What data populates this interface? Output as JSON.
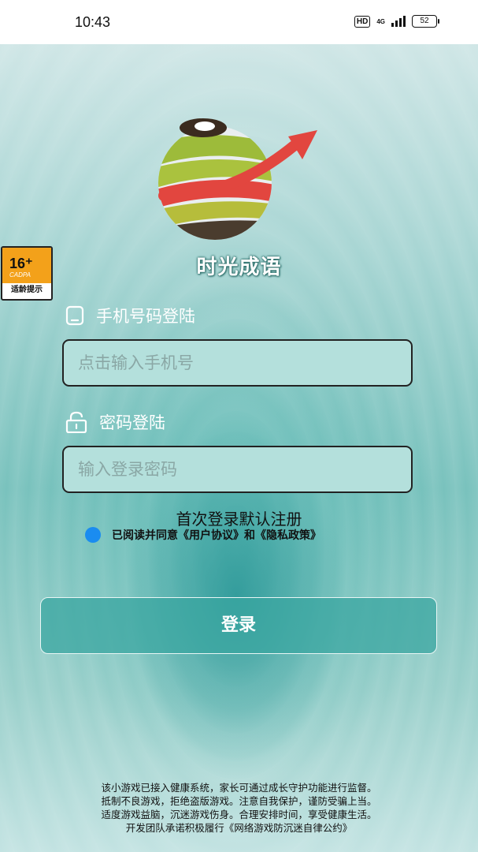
{
  "status_bar": {
    "time": "10:43",
    "hd": "HD",
    "network": "4G",
    "battery": "52"
  },
  "age_badge": {
    "rating": "16⁺",
    "org": "CADPA",
    "caption": "适龄提示"
  },
  "app": {
    "title": "时光成语"
  },
  "login": {
    "phone_label": "手机号码登陆",
    "phone_placeholder": "点击输入手机号",
    "password_label": "密码登陆",
    "password_placeholder": "输入登录密码",
    "register_note": "首次登录默认注册",
    "agreement_text": "已阅读并同意《用户协议》和《隐私政策》",
    "login_button": "登录"
  },
  "footer": {
    "lines": [
      "该小游戏已接入健康系统，家长可通过成长守护功能进行监督。",
      "抵制不良游戏，拒绝盗版游戏。注意自我保护，谨防受骗上当。",
      "适度游戏益脑，沉迷游戏伤身。合理安排时间，享受健康生活。",
      "开发团队承诺积极履行《网络游戏防沉迷自律公约》"
    ]
  },
  "colors": {
    "accent_blue": "#1a8cf0",
    "badge_orange": "#f3a11a",
    "teal": "#3aa5a0"
  }
}
